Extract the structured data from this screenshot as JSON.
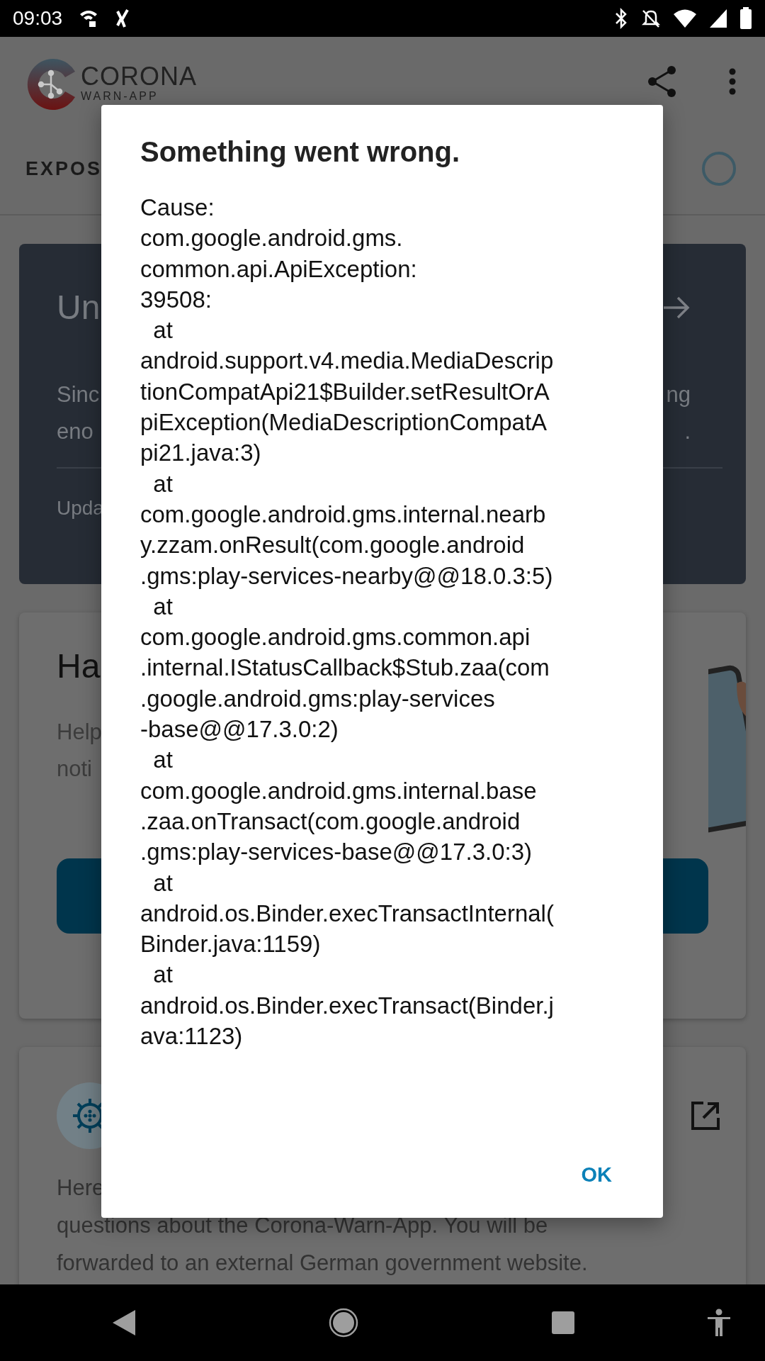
{
  "status_bar": {
    "time": "09:03"
  },
  "app_bar": {
    "logo_title": "CORONA",
    "logo_subtitle": "WARN-APP",
    "tab_label": "EXPOS"
  },
  "risk_card": {
    "title": "Un",
    "rows": [
      {
        "left": "Sinc",
        "right": "ng"
      },
      {
        "left": "eno",
        "right": "."
      }
    ],
    "footer": "Upda"
  },
  "share_card": {
    "title": "Ha",
    "rows": [
      "Help",
      "noti"
    ]
  },
  "faq_card": {
    "rows": [
      "Here",
      "questions about the Corona-Warn-App. You will be",
      "forwarded to an external German government website."
    ]
  },
  "dialog": {
    "title": "Something went wrong.",
    "message_lines": [
      "Cause:",
      "com.google.android.gms.",
      "common.api.ApiException:",
      "39508:",
      "  at",
      "android.support.v4.media.MediaDescrip",
      "tionCompatApi21$Builder.setResultOrA",
      "piException(MediaDescriptionCompatA",
      "pi21.java:3)",
      "  at",
      "com.google.android.gms.internal.nearb",
      "y.zzam.onResult(com.google.android",
      ".gms:play-services-nearby@@18.0.3:5)",
      "  at",
      "com.google.android.gms.common.api",
      ".internal.IStatusCallback$Stub.zaa(com",
      ".google.android.gms:play-services",
      "-base@@17.3.0:2)",
      "  at",
      "com.google.android.gms.internal.base",
      ".zaa.onTransact(com.google.android",
      ".gms:play-services-base@@17.3.0:3)",
      "  at",
      "android.os.Binder.execTransactInternal(",
      "Binder.java:1159)",
      "  at",
      "android.os.Binder.execTransact(Binder.j",
      "ava:1123)"
    ],
    "button": "OK"
  }
}
